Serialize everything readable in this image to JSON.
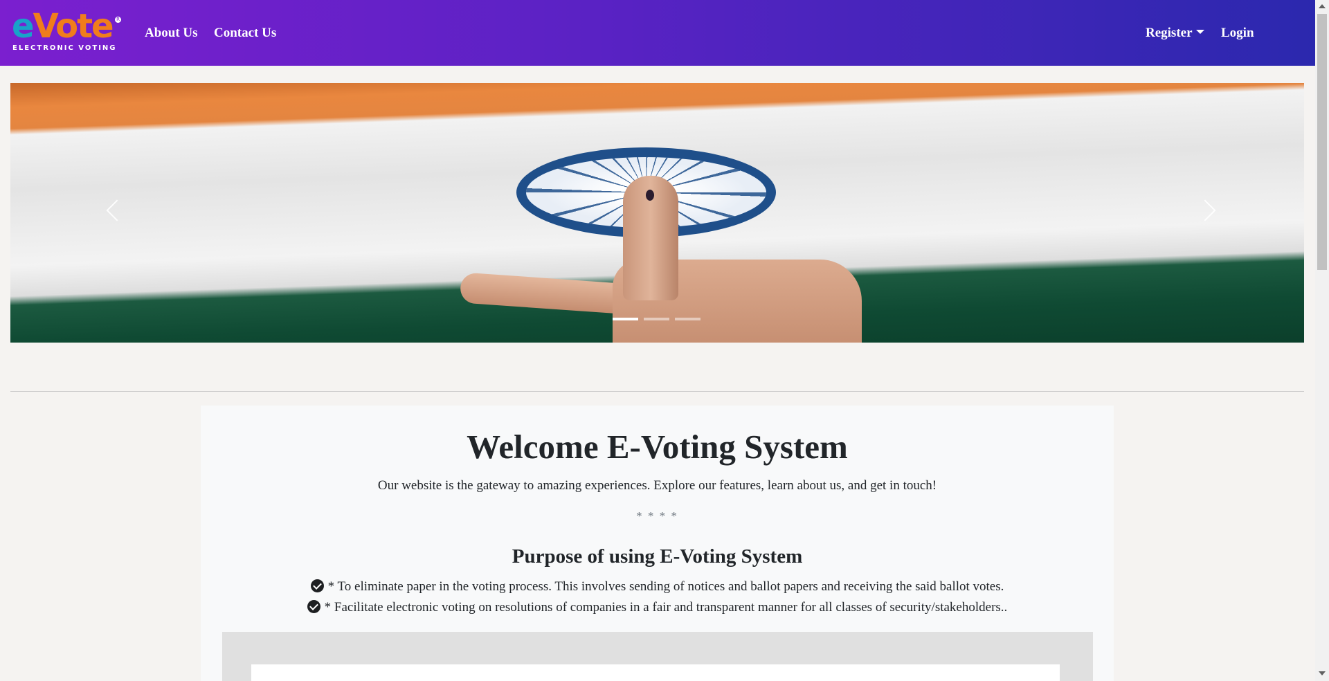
{
  "navbar": {
    "logo": {
      "e": "e",
      "vote": "Vote",
      "reg": "R",
      "sub": "ELECTRONIC VOTING"
    },
    "links": {
      "about": "About Us",
      "contact": "Contact Us"
    },
    "right": {
      "register": "Register",
      "login": "Login"
    },
    "colors": {
      "gradient_start": "#7b1fcf",
      "gradient_end": "#2b28ae"
    }
  },
  "carousel": {
    "image": "indian-flag-inked-finger-vote",
    "slide_count": 3,
    "active_slide": 1
  },
  "welcome": {
    "title": "Welcome E-Voting System",
    "lead": "Our website is the gateway to amazing experiences. Explore our features, learn about us, and get in touch!",
    "stars": "* * * *",
    "purpose_title": "Purpose of using E-Voting System",
    "points": [
      "* To eliminate paper in the voting process. This involves sending of notices and ballot papers and receiving the said ballot votes.",
      "* Facilitate electronic voting on resolutions of companies in a fair and transparent manner for all classes of security/stakeholders.."
    ]
  }
}
